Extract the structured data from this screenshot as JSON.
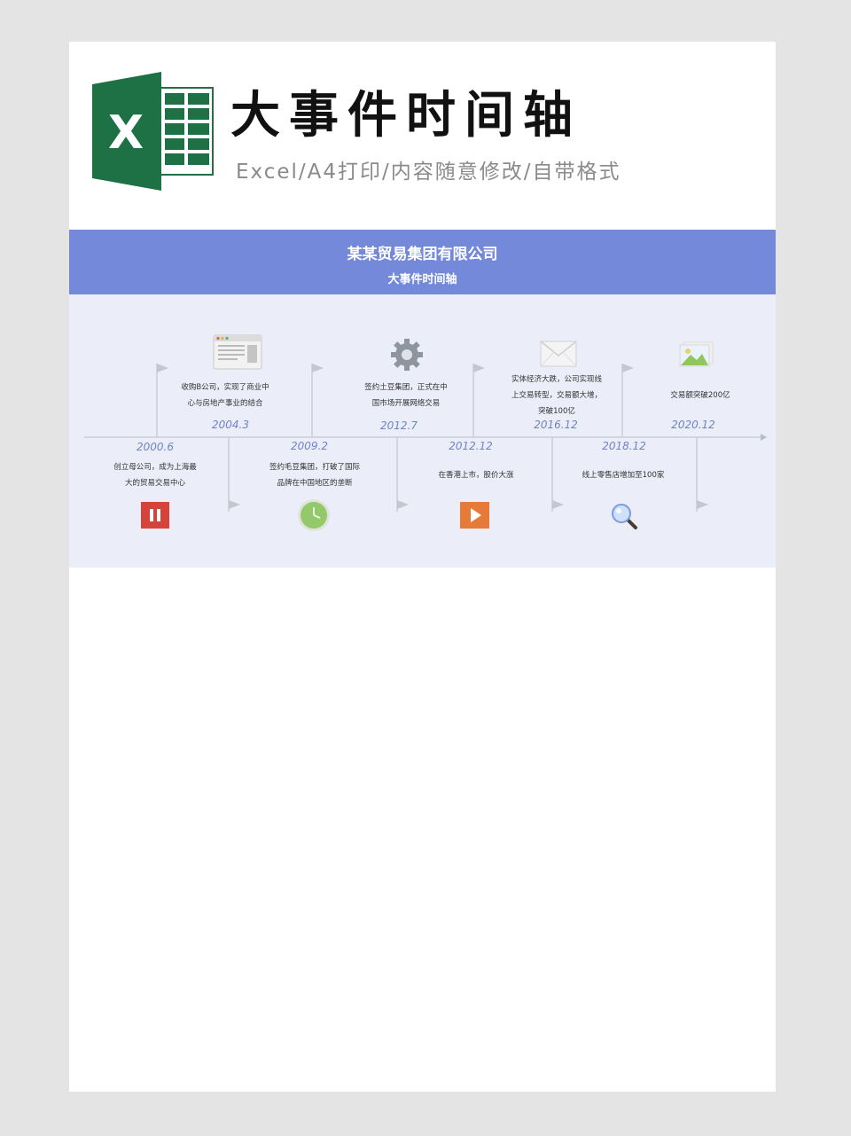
{
  "header": {
    "title": "大事件时间轴",
    "subtitle": "Excel/A4打印/内容随意修改/自带格式",
    "logo_letter": "X"
  },
  "banner": {
    "company": "某某贸易集团有限公司",
    "sheet_title": "大事件时间轴"
  },
  "colors": {
    "excel_green": "#1e7145",
    "banner": "#7489d9",
    "timeline_bg": "#ebedf8",
    "year_text": "#6f84c6"
  },
  "timeline": {
    "top_events": [
      {
        "year": "2004.3",
        "desc_lines": [
          "收购B公司，实现了商业中",
          "心与房地产事业的结合"
        ],
        "icon": "browser-window-icon"
      },
      {
        "year": "2012.7",
        "desc_lines": [
          "签约土豆集团，正式在中",
          "国市场开展网络交易"
        ],
        "icon": "gear-icon"
      },
      {
        "year": "2016.12",
        "desc_lines": [
          "实体经济大跌，公司实现线",
          "上交易转型，交易额大增，",
          "突破100亿"
        ],
        "icon": "envelope-icon"
      },
      {
        "year": "2020.12",
        "desc_lines": [
          "交易额突破200亿"
        ],
        "icon": "image-icon"
      }
    ],
    "bottom_events": [
      {
        "year": "2000.6",
        "desc_lines": [
          "创立母公司，成为上海最",
          "大的贸易交易中心"
        ],
        "icon": "pause-icon"
      },
      {
        "year": "2009.2",
        "desc_lines": [
          "签约毛豆集团，打破了国际",
          "品牌在中国地区的垄断"
        ],
        "icon": "clock-icon"
      },
      {
        "year": "2012.12",
        "desc_lines": [
          "在香港上市，股价大涨"
        ],
        "icon": "play-icon"
      },
      {
        "year": "2018.12",
        "desc_lines": [
          "线上零售店增加至100家"
        ],
        "icon": "magnifier-icon"
      }
    ]
  }
}
